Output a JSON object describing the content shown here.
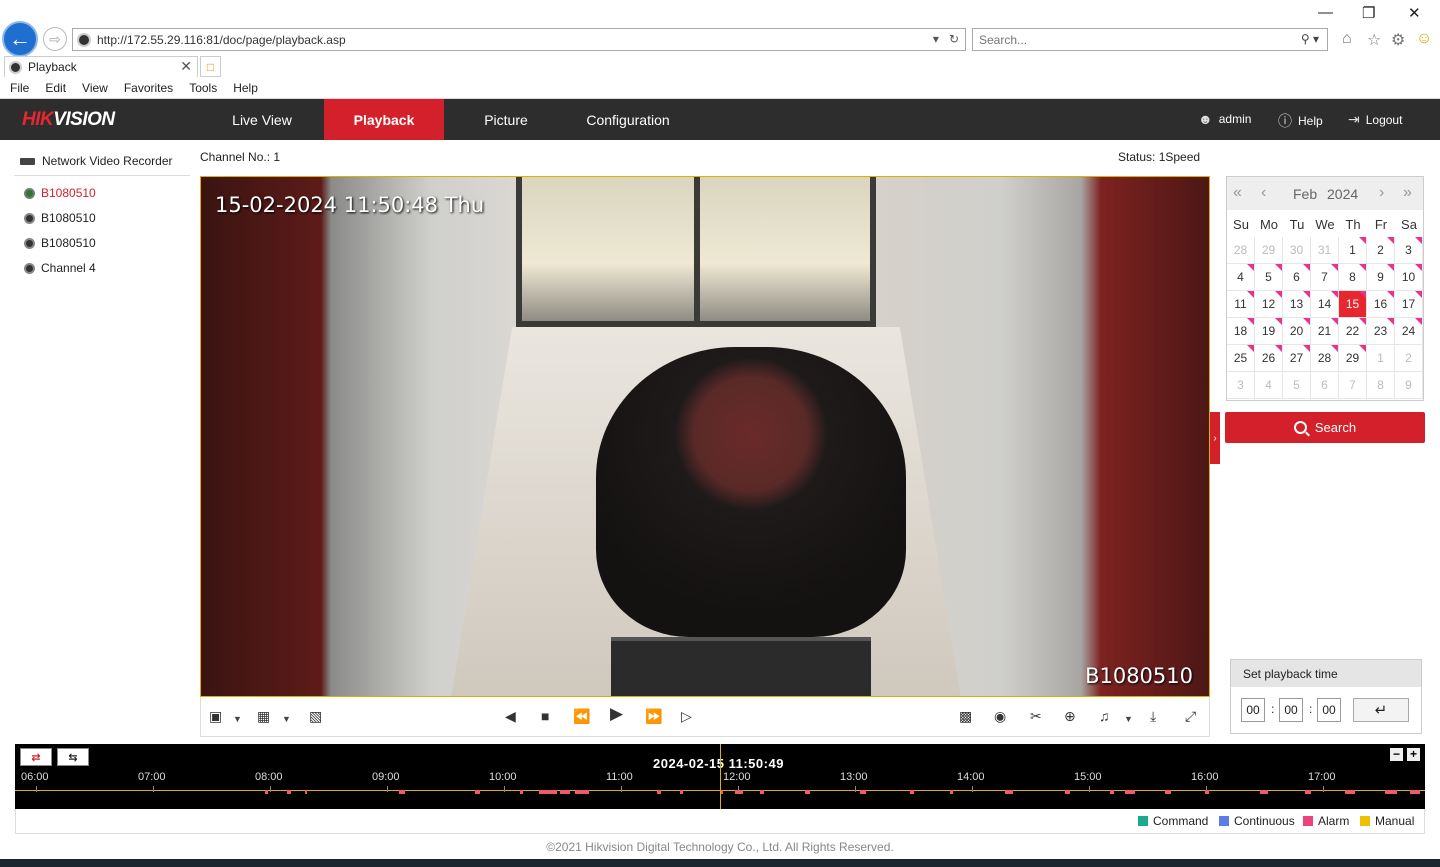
{
  "browser": {
    "url": "http://172.55.29.116:81/doc/page/playback.asp",
    "search_placeholder": "Search...",
    "tab_title": "Playback",
    "menu": [
      "File",
      "Edit",
      "View",
      "Favorites",
      "Tools",
      "Help"
    ]
  },
  "header": {
    "logo": "HIKVISION",
    "nav": [
      "Live View",
      "Playback",
      "Picture",
      "Configuration"
    ],
    "active_tab": "Playback",
    "user": "admin",
    "help": "Help",
    "logout": "Logout"
  },
  "sidebar": {
    "root": "Network Video Recorder",
    "cameras": [
      "B1080510",
      "B1080510",
      "B1080510",
      "Channel 4"
    ],
    "selected_index": 0
  },
  "player": {
    "channel_label": "Channel No.: 1",
    "status_label": "Status: 1Speed",
    "osd_time": "15-02-2024 11:50:48 Thu",
    "osd_name": "B1080510"
  },
  "calendar": {
    "month": "Feb",
    "year": "2024",
    "dow": [
      "Su",
      "Mo",
      "Tu",
      "We",
      "Th",
      "Fr",
      "Sa"
    ],
    "days": [
      [
        "28",
        "29",
        "30",
        "31",
        "1",
        "2",
        "3"
      ],
      [
        "4",
        "5",
        "6",
        "7",
        "8",
        "9",
        "10"
      ],
      [
        "11",
        "12",
        "13",
        "14",
        "15",
        "16",
        "17"
      ],
      [
        "18",
        "19",
        "20",
        "21",
        "22",
        "23",
        "24"
      ],
      [
        "25",
        "26",
        "27",
        "28",
        "29",
        "1",
        "2"
      ],
      [
        "3",
        "4",
        "5",
        "6",
        "7",
        "8",
        "9"
      ]
    ],
    "selected_day": "15",
    "search_label": "Search"
  },
  "playback_time": {
    "title": "Set playback time",
    "hh": "00",
    "mm": "00",
    "ss": "00"
  },
  "timeline": {
    "current": "2024-02-15 11:50:49",
    "hours": [
      "06:00",
      "07:00",
      "08:00",
      "09:00",
      "10:00",
      "11:00",
      "12:00",
      "13:00",
      "14:00",
      "15:00",
      "16:00",
      "17:00"
    ]
  },
  "legend": [
    {
      "label": "Command",
      "color": "#1aaa8f"
    },
    {
      "label": "Continuous",
      "color": "#5b7de8"
    },
    {
      "label": "Alarm",
      "color": "#f0427a"
    },
    {
      "label": "Manual",
      "color": "#f0c000"
    }
  ],
  "footer": {
    "copyright": "©2021 Hikvision Digital Technology Co., Ltd. All Rights Reserved."
  },
  "colors": {
    "accent": "#d3202b",
    "header_bg": "#2d2d2d",
    "record_marker": "#e6358f"
  }
}
